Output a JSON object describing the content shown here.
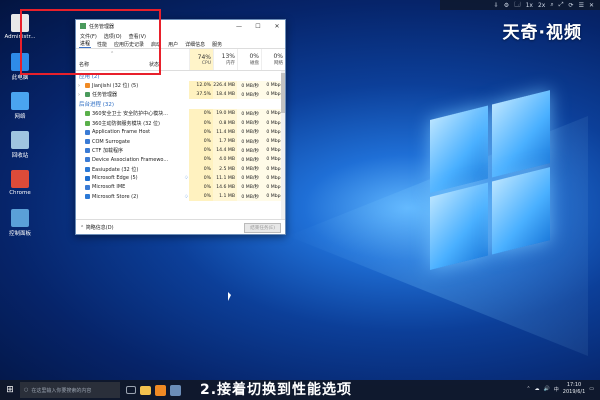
{
  "overlay": {
    "topbar_items": [
      "⇩",
      "⚙",
      "🗔",
      "1x",
      "2x",
      "⌕",
      "⤢",
      "⟳",
      "☰",
      "✕"
    ],
    "watermark": "天奇·视频",
    "caption": "2.接着切换到性能选项"
  },
  "desktop_icons": [
    {
      "label": "Administr...",
      "color": "#e8e8e8"
    },
    {
      "label": "此电脑",
      "color": "#2e8be8"
    },
    {
      "label": "网络",
      "color": "#4aa4f0"
    },
    {
      "label": "回收站",
      "color": "#9fc4e0"
    },
    {
      "label": "Chrome",
      "color": "#dd4b39"
    },
    {
      "label": "控制面板",
      "color": "#5aa0d8"
    }
  ],
  "task_manager": {
    "title": "任务管理器",
    "window_buttons": [
      "—",
      "☐",
      "✕"
    ],
    "menu": [
      "文件(F)",
      "选项(O)",
      "查看(V)"
    ],
    "tabs": [
      "进程",
      "性能",
      "应用历史记录",
      "启动",
      "用户",
      "详细信息",
      "服务"
    ],
    "active_tab": "进程",
    "header": {
      "name_label": "名称",
      "status_label": "状态",
      "cpu_pct": "74%",
      "cpu_label": "CPU",
      "mem_pct": "13%",
      "mem_label": "内存",
      "disk_pct": "0%",
      "disk_label": "磁盘",
      "net_pct": "0%",
      "net_label": "网络"
    },
    "group_apps": "应用 (2)",
    "apps": [
      {
        "name": "Jianjishi (32 位) (5)",
        "cpu": "12.0%",
        "mem": "226.4 MB",
        "disk": "0 MB/秒",
        "net": "0 Mbps",
        "icon_color": "#f08a24"
      },
      {
        "name": "任务管理器",
        "cpu": "37.5%",
        "mem": "18.4 MB",
        "disk": "0 MB/秒",
        "net": "0 Mbps",
        "icon_color": "#4a9a5c"
      }
    ],
    "group_background": "后台进程 (32)",
    "background": [
      {
        "name": "360安全卫士 安全防护中心模块...",
        "cpu": "0%",
        "mem": "19.0 MB",
        "disk": "0 MB/秒",
        "net": "0 Mbps",
        "icon_color": "#5ab04a"
      },
      {
        "name": "360主动防御服务模块 (32 位)",
        "cpu": "0%",
        "mem": "0.8 MB",
        "disk": "0 MB/秒",
        "net": "0 Mbps",
        "icon_color": "#5ab04a"
      },
      {
        "name": "Application Frame Host",
        "cpu": "0%",
        "mem": "11.4 MB",
        "disk": "0 MB/秒",
        "net": "0 Mbps",
        "icon_color": "#3a7bd5"
      },
      {
        "name": "COM Surrogate",
        "cpu": "0%",
        "mem": "1.7 MB",
        "disk": "0 MB/秒",
        "net": "0 Mbps",
        "icon_color": "#3a7bd5"
      },
      {
        "name": "CTF 加载程序",
        "cpu": "0%",
        "mem": "14.4 MB",
        "disk": "0 MB/秒",
        "net": "0 Mbps",
        "icon_color": "#3a7bd5"
      },
      {
        "name": "Device Association Framewo...",
        "cpu": "0%",
        "mem": "4.0 MB",
        "disk": "0 MB/秒",
        "net": "0 Mbps",
        "icon_color": "#3a7bd5"
      },
      {
        "name": "Easiupdate (32 位)",
        "cpu": "0%",
        "mem": "2.5 MB",
        "disk": "0 MB/秒",
        "net": "0 Mbps",
        "icon_color": "#2b79d6"
      },
      {
        "name": "Microsoft Edge (5)",
        "cpu": "0%",
        "mem": "11.1 MB",
        "disk": "0 MB/秒",
        "net": "0 Mbps",
        "icon_color": "#1d6fd1",
        "leaf": true
      },
      {
        "name": "Microsoft IME",
        "cpu": "0%",
        "mem": "14.6 MB",
        "disk": "0 MB/秒",
        "net": "0 Mbps",
        "icon_color": "#3a7bd5"
      },
      {
        "name": "Microsoft Store (2)",
        "cpu": "0%",
        "mem": "1.1 MB",
        "disk": "0 MB/秒",
        "net": "0 Mbps",
        "icon_color": "#2b79d6",
        "leaf": true
      }
    ],
    "footer_less": "简略信息(D)",
    "footer_end": "结束任务(E)"
  },
  "taskbar": {
    "search_placeholder": "在这里输入你要搜索的内容",
    "time": "17:10",
    "date": "2019/6/1",
    "tray_icons": [
      "⌃",
      "☁",
      "🔊",
      "中"
    ]
  }
}
